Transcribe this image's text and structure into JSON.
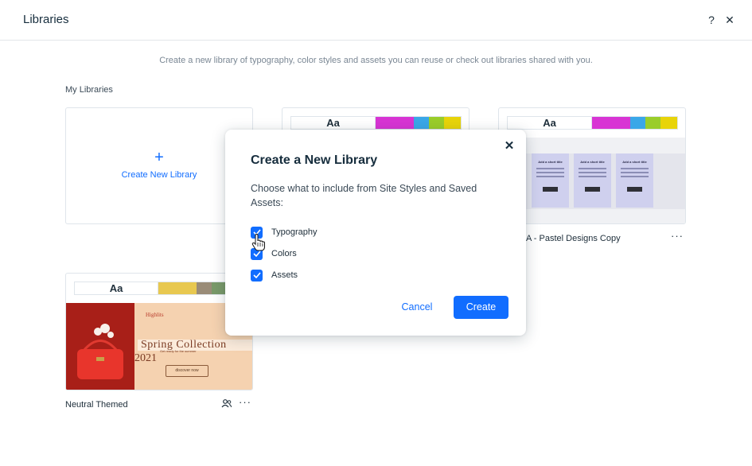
{
  "header": {
    "title": "Libraries",
    "help_icon": "?",
    "close_icon": "✕"
  },
  "subtitle": "Create a new library of typography, color styles and assets you can reuse or check out libraries shared with you.",
  "section_label": "My Libraries",
  "create_card": {
    "plus": "+",
    "label": "Create New Library"
  },
  "libraries": [
    {
      "name": "",
      "aa": "Aa",
      "colors": [
        "#d834d4",
        "#3aa7e8",
        "#9acd2a",
        "#c8d81c",
        "#e8d40a"
      ]
    },
    {
      "name": "A - Pastel Designs Copy",
      "aa": "Aa",
      "colors": [
        "#d834d4",
        "#3aa7e8",
        "#9acd2a",
        "#c8d81c",
        "#e8d40a"
      ],
      "more": "···",
      "preview": {
        "card_title": "Add a short title",
        "button": "Learn more"
      }
    },
    {
      "name": "Neutral Themed",
      "aa": "Aa",
      "colors": [
        "#e8c850",
        "#9a8c78",
        "#7a9a6a"
      ],
      "more": "···",
      "preview": {
        "brand": "Highlits",
        "headline": "Spring Collection",
        "year": "2021",
        "tagline": "Get ready for the summer",
        "button": "discover now"
      }
    }
  ],
  "modal": {
    "title": "Create a New Library",
    "description": "Choose what to include from Site Styles and Saved Assets:",
    "close_icon": "✕",
    "options": [
      {
        "label": "Typography",
        "checked": true
      },
      {
        "label": "Colors",
        "checked": true
      },
      {
        "label": "Assets",
        "checked": true
      }
    ],
    "cancel": "Cancel",
    "create": "Create"
  },
  "colors": {
    "accent": "#116dff",
    "title": "#162d3d"
  }
}
